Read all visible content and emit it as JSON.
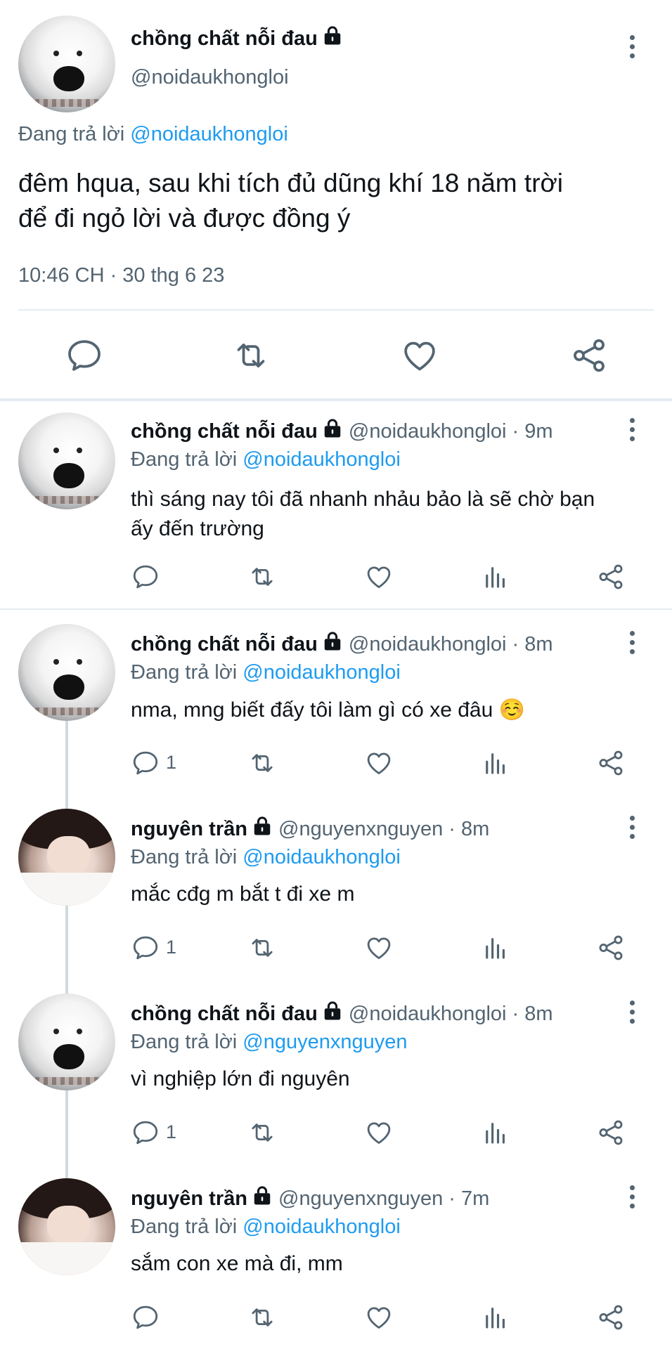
{
  "main_tweet": {
    "author_name": "chồng chất nỗi đau",
    "author_handle": "@noidaukhongloi",
    "reply_prefix": "Đang trả lời",
    "reply_to": "@noidaukhongloi",
    "text_line1": "đêm hqua, sau khi tích đủ dũng khí 18 năm trời",
    "text_line2": "để đi ngỏ lời và được đồng ý",
    "timestamp": "10:46 CH · 30 thg 6 23"
  },
  "replies": [
    {
      "name": "chồng chất nỗi đau",
      "handle_time": "@noidaukhongloi · 9m",
      "reply_prefix": "Đang trả lời",
      "reply_to": "@noidaukhongloi",
      "text_line1": "thì sáng nay tôi đã nhanh nhảu bảo là sẽ chờ bạn",
      "text_line2": "ấy đến trường",
      "reply_count": ""
    },
    {
      "name": "chồng chất nỗi đau",
      "handle_time": "@noidaukhongloi · 8m",
      "reply_prefix": "Đang trả lời",
      "reply_to": "@noidaukhongloi",
      "text_line1": "nma, mng biết đấy tôi làm gì có xe đâu ☺️",
      "reply_count": "1"
    },
    {
      "name": "nguyên trần",
      "handle_time": "@nguyenxnguyen · 8m",
      "reply_prefix": "Đang trả lời",
      "reply_to": "@noidaukhongloi",
      "text_line1": "mắc cđg m bắt t đi xe m",
      "reply_count": "1"
    },
    {
      "name": "chồng chất nỗi đau",
      "handle_time": "@noidaukhongloi · 8m",
      "reply_prefix": "Đang trả lời",
      "reply_to": "@nguyenxnguyen",
      "text_line1": "vì nghiệp lớn đi nguyên",
      "reply_count": "1"
    },
    {
      "name": "nguyên trần",
      "handle_time": "@nguyenxnguyen · 7m",
      "reply_prefix": "Đang trả lời",
      "reply_to": "@noidaukhongloi",
      "text_line1": "sắm con xe mà đi, mm",
      "reply_count": ""
    }
  ],
  "icons": [
    "reply-icon",
    "retweet-icon",
    "like-icon",
    "analytics-icon",
    "share-icon",
    "lock-icon",
    "more-icon"
  ]
}
